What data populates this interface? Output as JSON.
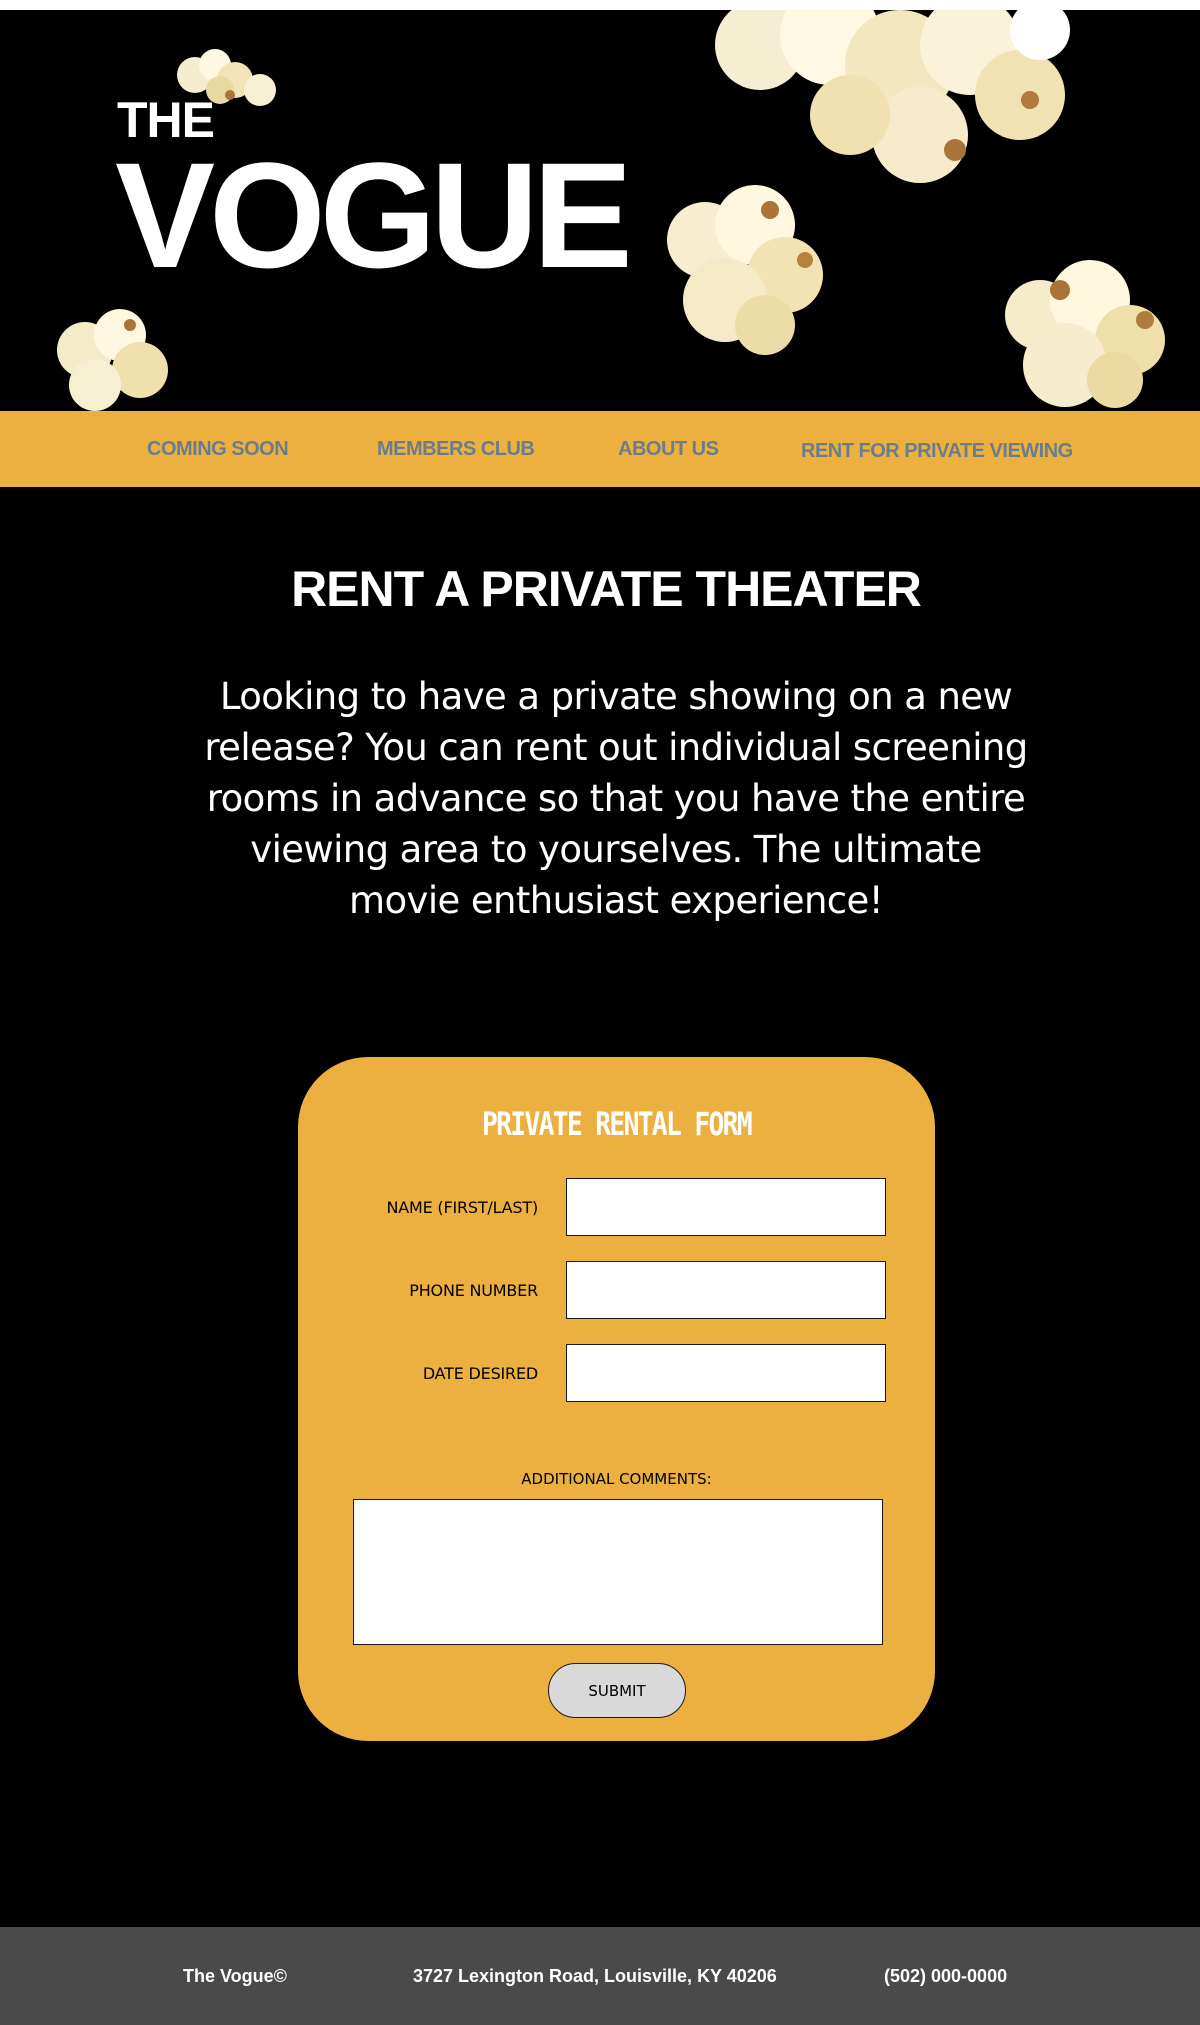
{
  "brand": {
    "the": "THE",
    "name": "VOGUE"
  },
  "nav": {
    "items": [
      {
        "label": "COMING SOON"
      },
      {
        "label": "MEMBERS CLUB"
      },
      {
        "label": "ABOUT US"
      },
      {
        "label": "RENT FOR PRIVATE VIEWING"
      }
    ]
  },
  "main": {
    "title": "RENT A PRIVATE THEATER",
    "intro": "Looking to have a private showing on a new release? You can rent out individual screening rooms in advance so that you have the entire viewing area to yourselves. The ultimate movie enthusiast experience!"
  },
  "form": {
    "title": "PRIVATE RENTAL FORM",
    "fields": [
      {
        "label": "NAME (FIRST/LAST)",
        "value": ""
      },
      {
        "label": "PHONE NUMBER",
        "value": ""
      },
      {
        "label": "DATE DESIRED",
        "value": ""
      }
    ],
    "comments_label": "ADDITIONAL COMMENTS:",
    "comments_value": "",
    "submit_label": "SUBMIT"
  },
  "footer": {
    "brand": "The Vogue©",
    "address": "3727 Lexington Road, Louisville, KY 40206",
    "phone": "(502) 000-0000"
  },
  "colors": {
    "accent": "#ecb040",
    "background": "#000000",
    "nav_text": "#6b7d8c",
    "footer": "#4a4a4a"
  }
}
